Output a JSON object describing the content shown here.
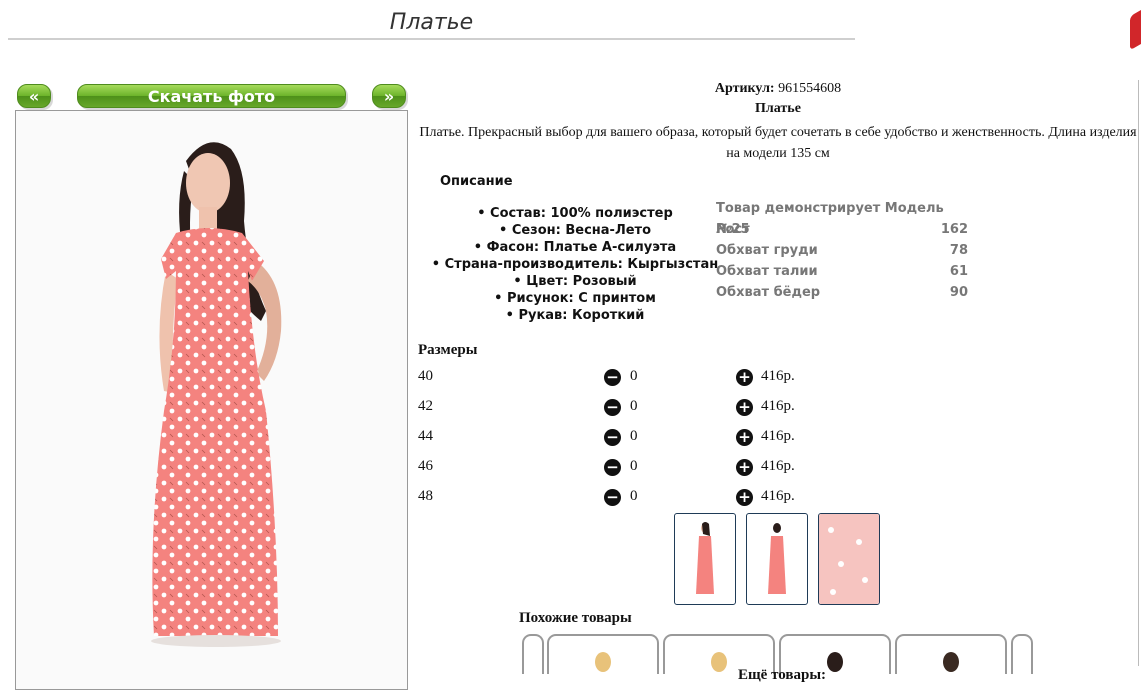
{
  "page": {
    "title": "Платье"
  },
  "gallery": {
    "prev_label": "«",
    "download_label": "Скачать фото",
    "next_label": "»"
  },
  "product": {
    "article_label": "Артикул:",
    "article_value": "961554608",
    "name": "Платье",
    "description": "Платье. Прекрасный выбор для вашего образа, который будет сочетать в себе удобство и женственность. Длина изделия на модели 135 см"
  },
  "description_section": {
    "heading": "Описание",
    "specs": [
      "Состав: 100% полиэстер",
      "Сезон: Весна-Лето",
      "Фасон: Платье А-силуэта",
      "Страна-производитель: Кыргызстан",
      "Цвет: Розовый",
      "Рисунок: С принтом",
      "Рукав: Короткий"
    ]
  },
  "model_info": {
    "header": "Товар демонстрирует Модель №25",
    "rows": [
      {
        "label": "Рост",
        "value": "162"
      },
      {
        "label": "Обхват груди",
        "value": "78"
      },
      {
        "label": "Обхват талии",
        "value": "61"
      },
      {
        "label": "Обхват бёдер",
        "value": "90"
      }
    ]
  },
  "sizes": {
    "heading": "Размеры",
    "minus_icon": "minus-circle-icon",
    "plus_icon": "plus-circle-icon",
    "rows": [
      {
        "size": "40",
        "qty": "0",
        "price": "416р."
      },
      {
        "size": "42",
        "qty": "0",
        "price": "416р."
      },
      {
        "size": "44",
        "qty": "0",
        "price": "416р."
      },
      {
        "size": "46",
        "qty": "0",
        "price": "416р."
      },
      {
        "size": "48",
        "qty": "0",
        "price": "416р."
      }
    ]
  },
  "similar": {
    "heading": "Похожие товары"
  },
  "more": {
    "heading": "Ещё товары:"
  },
  "colors": {
    "accent_green": "#6cb32a",
    "dress_pink": "#f4837f",
    "close_red": "#d1262a"
  }
}
